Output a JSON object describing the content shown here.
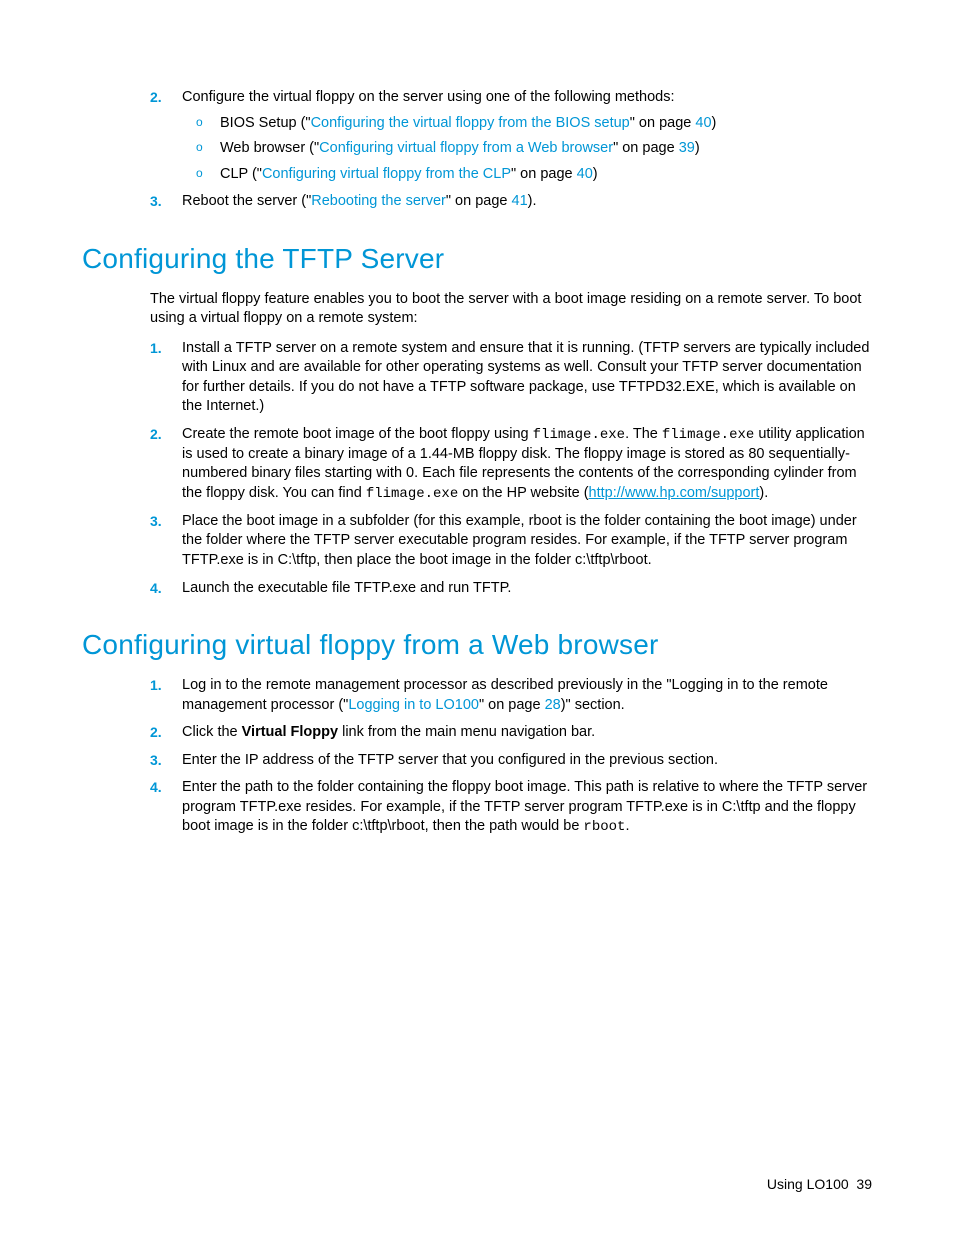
{
  "top": {
    "item2": "Configure the virtual floppy on the server using one of the following methods:",
    "sub_a_pre": "BIOS Setup (\"",
    "sub_a_link": "Configuring the virtual floppy from the BIOS setup",
    "sub_a_mid": "\" on page ",
    "sub_a_page": "40",
    "sub_a_end": ")",
    "sub_b_pre": "Web browser (\"",
    "sub_b_link": "Configuring virtual floppy from a Web browser",
    "sub_b_mid": "\" on page ",
    "sub_b_page": "39",
    "sub_b_end": ")",
    "sub_c_pre": "CLP (\"",
    "sub_c_link": "Configuring virtual floppy from the CLP",
    "sub_c_mid": "\" on page ",
    "sub_c_page": "40",
    "sub_c_end": ")",
    "item3_pre": "Reboot the server (\"",
    "item3_link": "Rebooting the server",
    "item3_mid": "\" on page ",
    "item3_page": "41",
    "item3_end": ")."
  },
  "h1": "Configuring the TFTP Server",
  "intro1": "The virtual floppy feature enables you to boot the server with a boot image residing on a remote server. To boot using a virtual floppy on a remote system:",
  "tftp": {
    "i1": "Install a TFTP server on a remote system and ensure that it is running. (TFTP servers are typically included with Linux and are available for other operating systems as well. Consult your TFTP server documentation for further details. If you do not have a TFTP software package, use TFTPD32.EXE, which is available on the Internet.)",
    "i2_a": "Create the remote boot image of the boot floppy using ",
    "i2_code1": "flimage.exe",
    "i2_b": ". The ",
    "i2_code2": "flimage.exe",
    "i2_c": " utility application is used to create a binary image of a 1.44-MB floppy disk. The floppy image is stored as 80 sequentially-numbered binary files starting with 0. Each file represents the contents of the corresponding cylinder from the floppy disk. You can find ",
    "i2_code3": "flimage.exe",
    "i2_d": " on the HP website (",
    "i2_url": "http://www.hp.com/support",
    "i2_e": ").",
    "i3": "Place the boot image in a subfolder (for this example, rboot is the folder containing the boot image) under the folder where the TFTP server executable program resides. For example, if the TFTP server program TFTP.exe is in C:\\tftp, then place the boot image in the folder c:\\tftp\\rboot.",
    "i4": "Launch the executable file TFTP.exe and run TFTP."
  },
  "h2": "Configuring virtual floppy from a Web browser",
  "web": {
    "i1_a": "Log in to the remote management processor as described previously in the \"Logging in to the remote management processor (\"",
    "i1_link": "Logging in to LO100",
    "i1_b": "\" on page ",
    "i1_page": "28",
    "i1_c": ")\" section.",
    "i2_a": "Click the ",
    "i2_bold": "Virtual Floppy",
    "i2_b": " link from the main menu navigation bar.",
    "i3": "Enter the IP address of the TFTP server that you configured in the previous section.",
    "i4_a": "Enter the path to the folder containing the floppy boot image. This path is relative to where the TFTP server program TFTP.exe resides. For example, if the TFTP server program TFTP.exe is in C:\\tftp and the floppy boot image is in the folder c:\\tftp\\rboot, then the path would be ",
    "i4_code": "rboot",
    "i4_b": "."
  },
  "footer_label": "Using LO100",
  "footer_page": "39"
}
